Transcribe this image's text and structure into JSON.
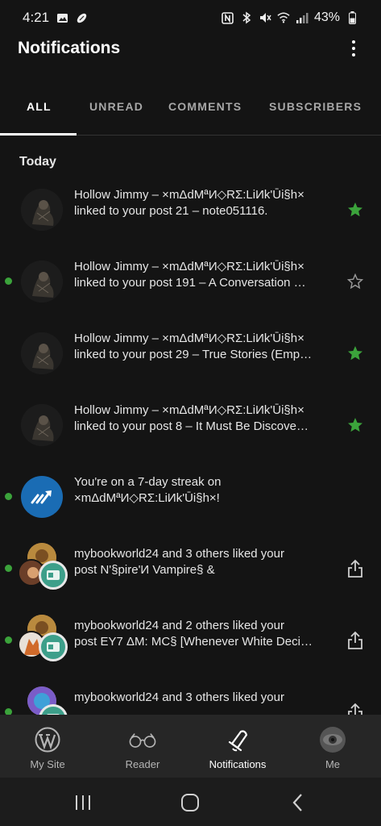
{
  "status_bar": {
    "time": "4:21",
    "battery": "43%"
  },
  "app_bar": {
    "title": "Notifications"
  },
  "tabs": [
    {
      "label": "ALL",
      "active": true
    },
    {
      "label": "UNREAD",
      "active": false
    },
    {
      "label": "COMMENTS",
      "active": false
    },
    {
      "label": "SUBSCRIBERS",
      "active": false
    }
  ],
  "section": {
    "label": "Today"
  },
  "notifications": [
    {
      "line1": "Hollow Jimmy – ×mΔdMªИ◇RΣ:LiИk'Ūi§h×",
      "line2": "linked to your post 21 – note051116.",
      "unread": false,
      "action": "star-filled-icon"
    },
    {
      "line1": "Hollow Jimmy – ×mΔdMªИ◇RΣ:LiИk'Ūi§h×",
      "line2": "linked to your post 191 – A Conversation …",
      "unread": true,
      "action": "star-outline-icon"
    },
    {
      "line1": "Hollow Jimmy – ×mΔdMªИ◇RΣ:LiИk'Ūi§h×",
      "line2": "linked to your post 29 – True Stories (Emp…",
      "unread": false,
      "action": "star-filled-icon"
    },
    {
      "line1": "Hollow Jimmy – ×mΔdMªИ◇RΣ:LiИk'Ūi§h×",
      "line2": "linked to your post 8 – It Must Be Discove…",
      "unread": false,
      "action": "star-filled-icon"
    },
    {
      "line1": "You're on a 7-day streak on",
      "line2": "×mΔdMªИ◇RΣ:LiИk'Ūi§h×!",
      "unread": true,
      "action": ""
    },
    {
      "line1": "mybookworld24 and 3 others liked your",
      "line2": "post N'§pire'И Vampire§ &",
      "unread": true,
      "action": "share-icon"
    },
    {
      "line1": "mybookworld24 and 2 others liked your",
      "line2": "post EY7 ΔM: MC§ [Whenever White Deci…",
      "unread": true,
      "action": "share-icon"
    },
    {
      "line1": "mybookworld24 and 3 others liked your",
      "line2": "",
      "unread": true,
      "action": "share-icon"
    }
  ],
  "bottom_nav": [
    {
      "label": "My Site",
      "icon": "wordpress-icon"
    },
    {
      "label": "Reader",
      "icon": "glasses-icon"
    },
    {
      "label": "Notifications",
      "icon": "bell-icon",
      "active": true
    },
    {
      "label": "Me",
      "icon": "avatar-icon"
    }
  ],
  "colors": {
    "accent_green": "#3ba33b",
    "background": "#141414",
    "nav_background": "#262626"
  }
}
